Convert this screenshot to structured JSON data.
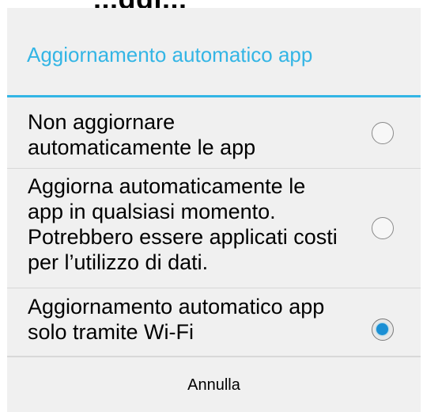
{
  "background": {
    "title": "...ggi..."
  },
  "dialog": {
    "title": "Aggiornamento automatico app",
    "options": [
      {
        "label": "Non aggiornare automaticamente le app",
        "selected": false
      },
      {
        "label": "Aggiorna automaticamente le app in qualsiasi momento. Potrebbero essere applicati costi per l’utilizzo di dati.",
        "selected": false
      },
      {
        "label": "Aggiornamento automatico app solo tramite Wi-Fi",
        "selected": true
      }
    ],
    "cancel_label": "Annulla"
  },
  "colors": {
    "accent": "#33b5e5",
    "radio_selected": "#1a8fd4",
    "dialog_background": "#f0f0f0"
  }
}
